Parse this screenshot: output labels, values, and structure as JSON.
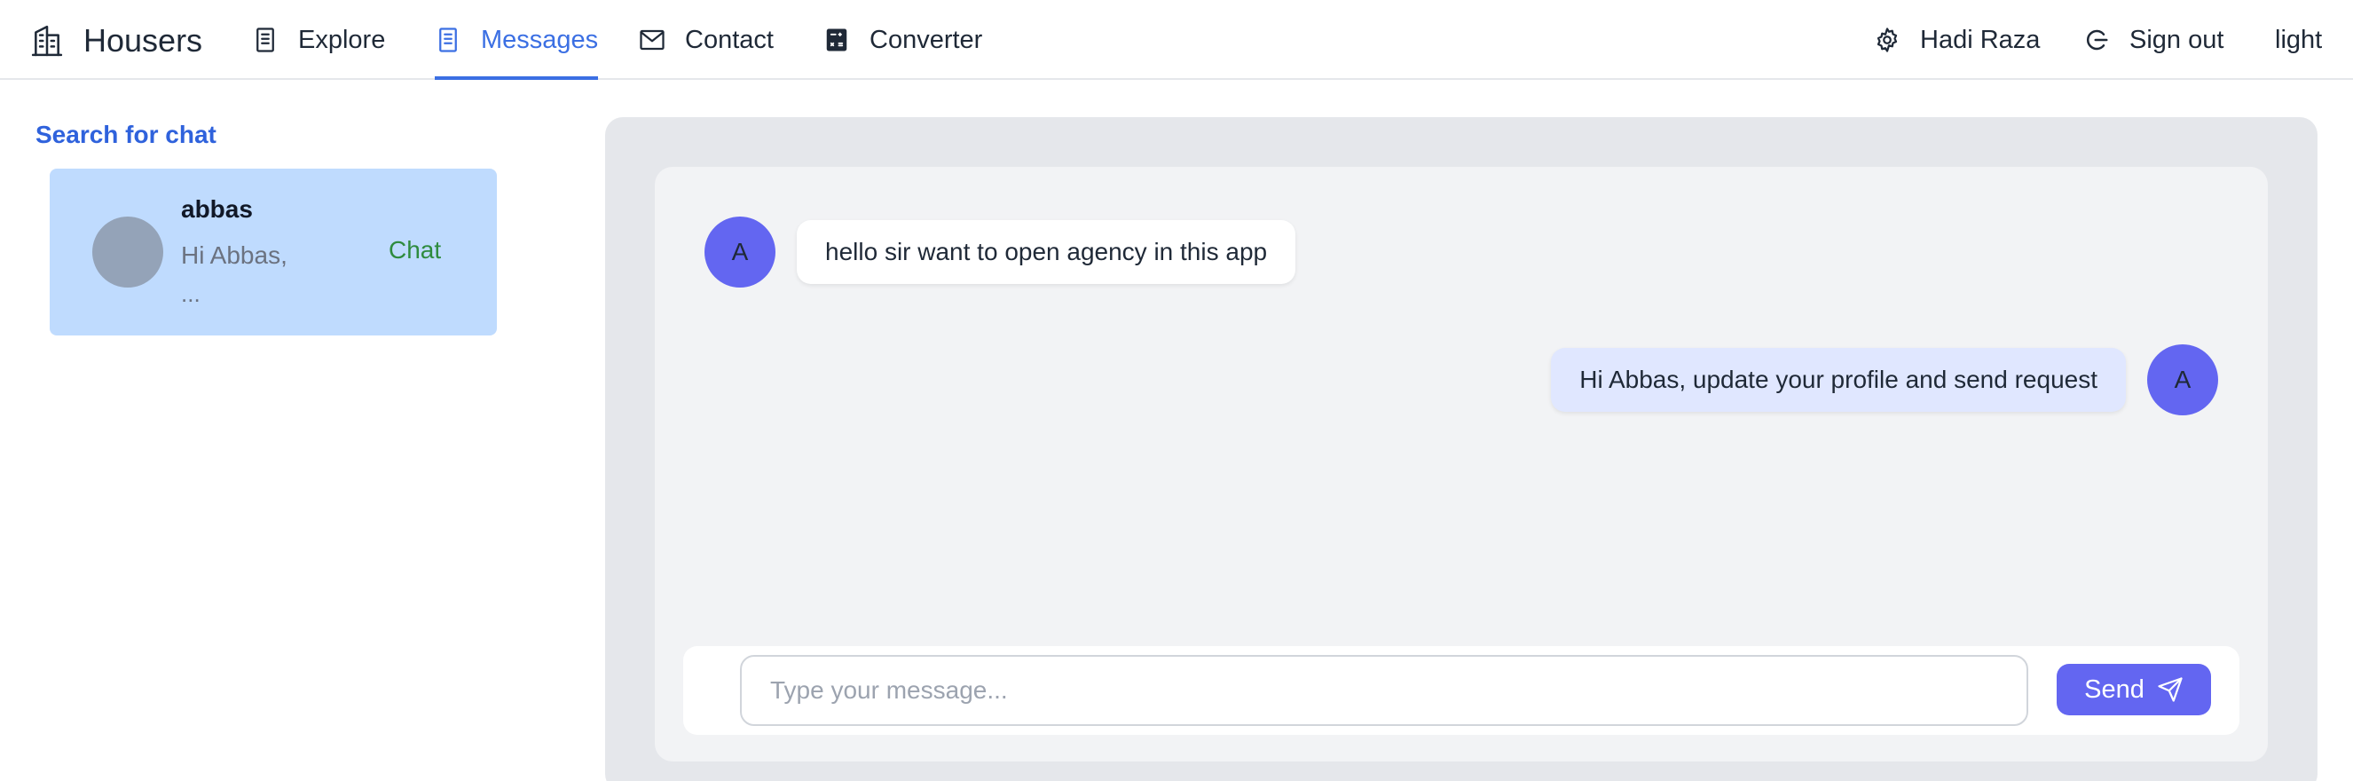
{
  "brand": {
    "name": "Housers"
  },
  "nav": {
    "explore": "Explore",
    "messages": "Messages",
    "contact": "Contact",
    "converter": "Converter",
    "user": "Hadi Raza",
    "signout": "Sign out",
    "theme": "light",
    "active_tab": "Messages"
  },
  "sidebar": {
    "title": "Search for chat",
    "chats": [
      {
        "name": "abbas",
        "preview": "Hi Abbas,",
        "preview_more": "...",
        "action": "Chat"
      }
    ]
  },
  "messages": [
    {
      "avatar": "A",
      "text": "hello sir want to open agency in this app",
      "side": "left"
    },
    {
      "avatar": "A",
      "text": "Hi Abbas, update your profile and send request",
      "side": "right"
    }
  ],
  "composer": {
    "placeholder": "Type your message...",
    "send_label": "Send"
  },
  "icons": {
    "brand": "building-icon",
    "explore": "building-list-icon",
    "messages": "building-list-icon",
    "contact": "envelope-icon",
    "converter": "calculator-icon",
    "user": "gear-icon",
    "signout": "logout-icon",
    "send": "paper-plane-icon"
  },
  "colors": {
    "accent": "#3b6fe3",
    "send_button": "#6366f1",
    "avatar": "#6366f1",
    "chat_card": "#bfdbfe",
    "chat_action": "#2e8b3e",
    "outgoing_bubble": "#e0e7ff"
  }
}
